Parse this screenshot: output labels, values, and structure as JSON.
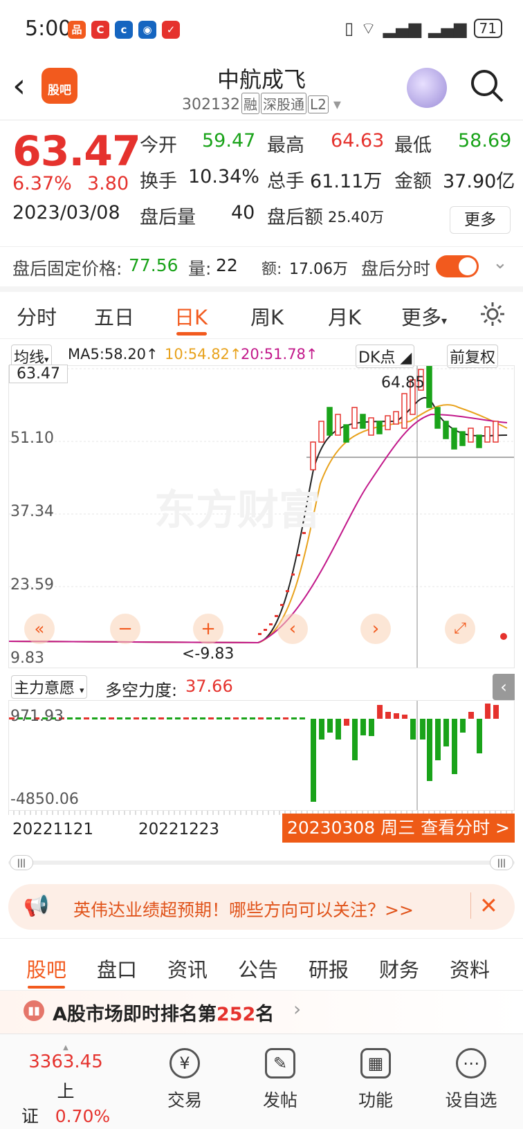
{
  "status": {
    "time": "5:00",
    "battery": "71",
    "apps": [
      {
        "t": "品",
        "c": "#f25a1e"
      },
      {
        "t": "C",
        "c": "#e5322d"
      },
      {
        "t": "c",
        "c": "#1565c0"
      },
      {
        "t": "◉",
        "c": "#1565c0"
      },
      {
        "t": "✓",
        "c": "#e5322d"
      }
    ]
  },
  "header": {
    "title": "中航成飞",
    "code": "302132",
    "tags": [
      "融",
      "深股通",
      "L2"
    ],
    "guba": "股吧"
  },
  "quote": {
    "price": "63.47",
    "pct": "6.37%",
    "chg": "3.80",
    "date": "2023/03/08",
    "open_l": "今开",
    "open": "59.47",
    "high_l": "最高",
    "high": "64.63",
    "low_l": "最低",
    "low": "58.69",
    "turn_l": "换手",
    "turn": "10.34%",
    "vol_l": "总手",
    "vol": "61.11万",
    "amt_l": "金额",
    "amt": "37.90亿",
    "avol_l": "盘后量",
    "avol": "40",
    "aamt_l": "盘后额",
    "aamt": "25.40万",
    "more": "更多"
  },
  "after": {
    "price_l": "盘后固定价格:",
    "price": "77.56",
    "vol_l": "量:",
    "vol": "22",
    "amt_l": "额:",
    "amt": "17.06万",
    "toggle_l": "盘后分时"
  },
  "tabs": [
    "分时",
    "五日",
    "日K",
    "周K",
    "月K",
    "更多"
  ],
  "chart": {
    "ma_sel": "均线",
    "ma5": "MA5:58.20↑",
    "ma10": "10:54.82↑",
    "ma20": "20:51.78↑",
    "dk": "DK点",
    "fq": "前复权",
    "y_labels": [
      "63.47",
      "51.10",
      "37.34",
      "23.59",
      "9.83"
    ],
    "max_label": "64.85",
    "min_label": "<-9.83",
    "watermark": "东方财富"
  },
  "indicator": {
    "sel": "主力意愿",
    "name": "多空力度:",
    "value": "37.66",
    "y_top": "971.93",
    "y_bot": "-4850.06"
  },
  "dates": {
    "d1": "20221121",
    "d2": "20221223",
    "info": "20230308 周三 查看分时 >"
  },
  "banner": {
    "text": "英伟达业绩超预期！哪些方向可以关注？>>"
  },
  "btabs": [
    "股吧",
    "盘口",
    "资讯",
    "公告",
    "研报",
    "财务",
    "资料"
  ],
  "rank": {
    "pre": "A股市场即时排名第",
    "num": "252",
    "post": "名"
  },
  "bottom": {
    "index_val": "3363.45",
    "index_name": "上证",
    "index_pct": "0.70%",
    "items": [
      {
        "label": "交易",
        "icon": "¥"
      },
      {
        "label": "发帖",
        "icon": "✎"
      },
      {
        "label": "功能",
        "icon": "▦"
      },
      {
        "label": "设自选",
        "icon": "⋯"
      }
    ]
  },
  "chart_data": {
    "type": "candlestick",
    "ylim": [
      9.83,
      63.47
    ],
    "ma5_last": 58.2,
    "ma10_last": 54.82,
    "ma20_last": 51.78,
    "high_mark": 64.85,
    "low_mark": 9.83,
    "close": 63.47
  }
}
